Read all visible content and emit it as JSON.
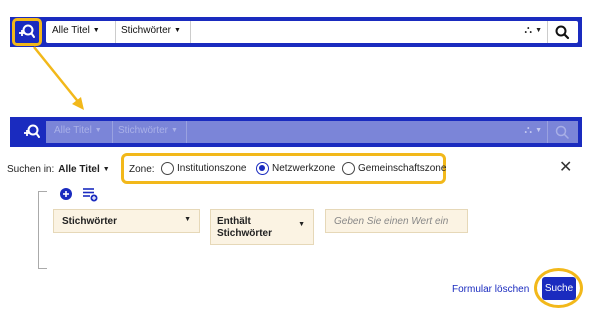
{
  "colors": {
    "primary": "#1a2bbf",
    "highlight": "#f2b81a",
    "field_bg": "#fbf3e3"
  },
  "top_bar": {
    "scope_label": "Alle Titel",
    "field_label": "Stichwörter",
    "advanced_icon": "advanced-search-icon",
    "filter_icon": "hierarchy-icon",
    "search_icon": "search-icon"
  },
  "disabled_bar": {
    "scope_label": "Alle Titel",
    "field_label": "Stichwörter"
  },
  "advanced_search": {
    "search_in_label": "Suchen in:",
    "search_in_value": "Alle Titel",
    "zone_label": "Zone:",
    "zones": [
      {
        "label": "Institutionszone",
        "selected": false
      },
      {
        "label": "Netzwerkzone",
        "selected": true
      },
      {
        "label": "Gemeinschaftszone",
        "selected": false
      }
    ],
    "close_symbol": "✕",
    "query_row": {
      "field": "Stichwörter",
      "operator": "Enthält Stichwörter",
      "value_placeholder": "Geben Sie einen Wert ein"
    },
    "clear_label": "Formular löschen",
    "search_label": "Suche"
  }
}
